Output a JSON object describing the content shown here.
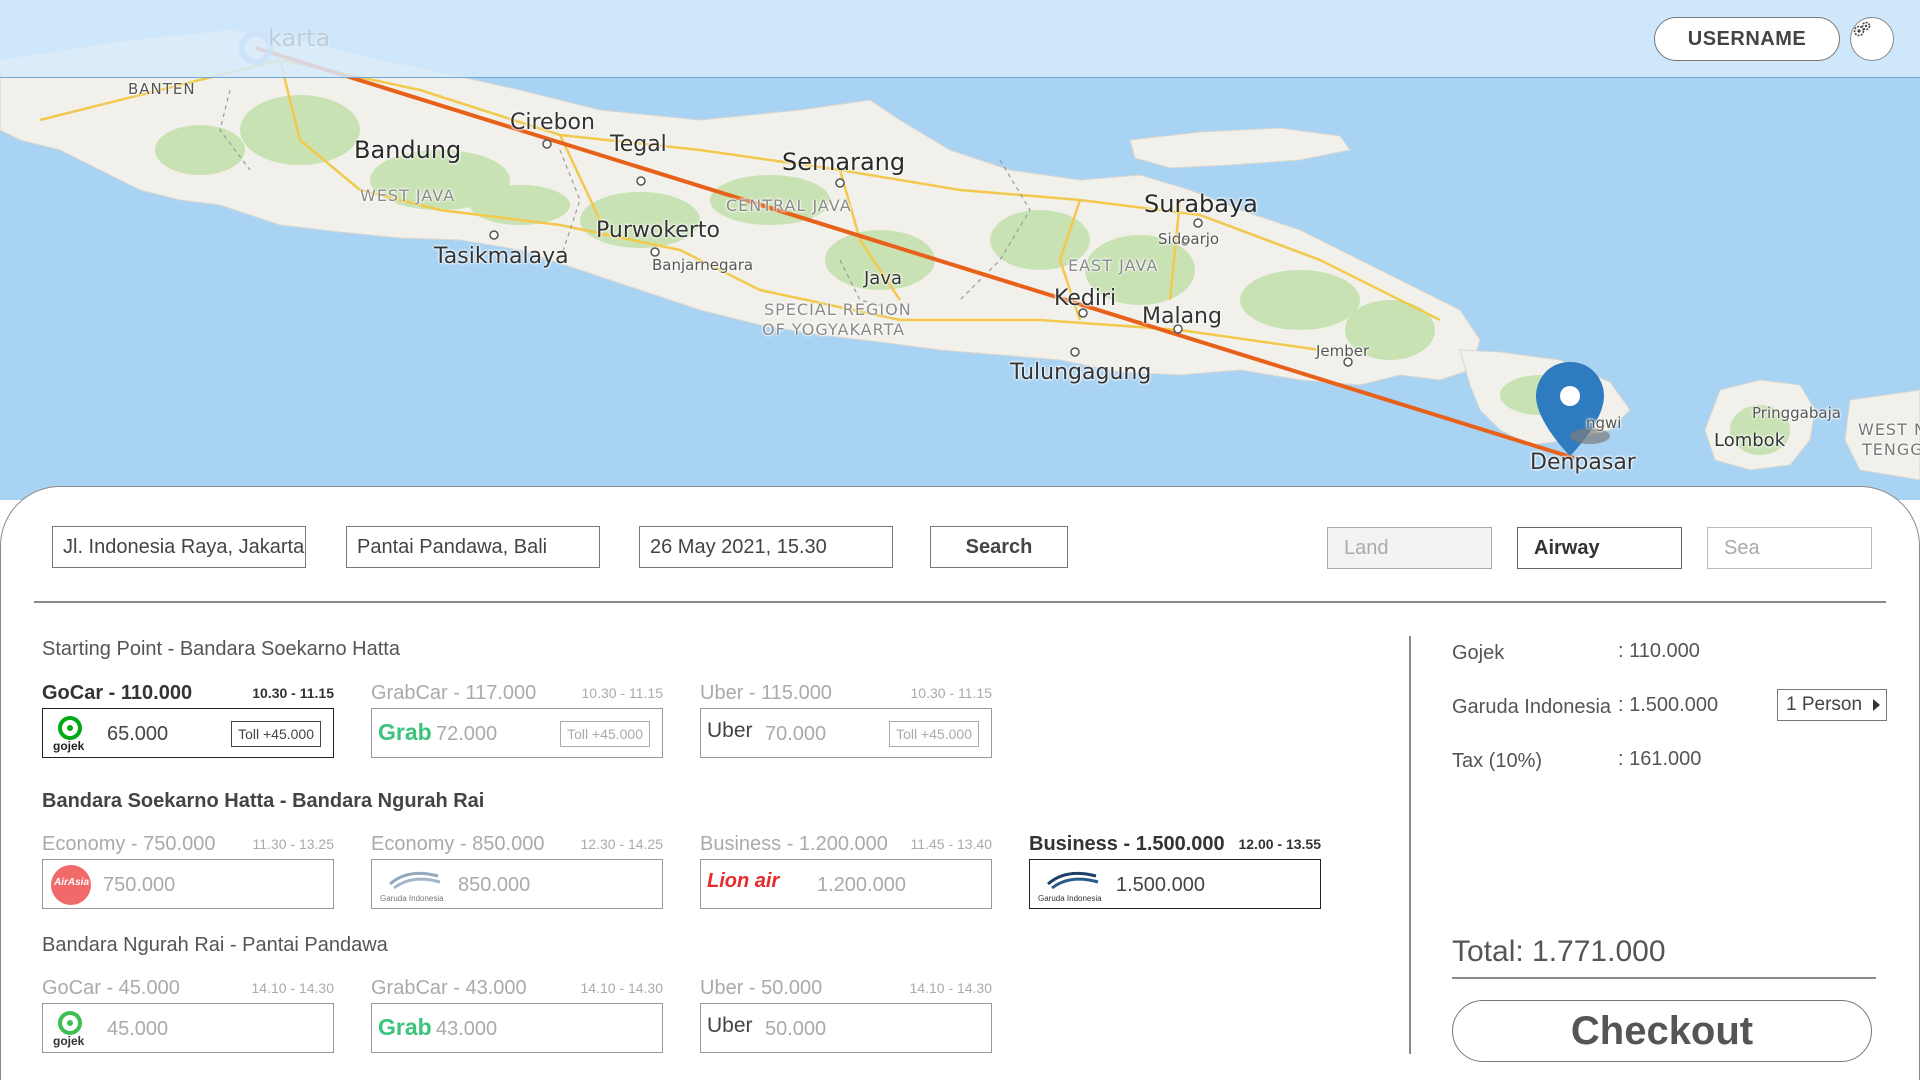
{
  "header": {
    "username": "USERNAME"
  },
  "map": {
    "labels": {
      "jakarta": "karta",
      "banten": "BANTEN",
      "cirebon": "Cirebon",
      "tegal": "Tegal",
      "bandung": "Bandung",
      "west_java": "WEST JAVA",
      "semarang": "Semarang",
      "central_java": "CENTRAL JAVA",
      "purwokerto": "Purwokerto",
      "banjarnegara": "Banjarnegara",
      "tasikmalaya": "Tasikmalaya",
      "java": "Java",
      "special_region": "SPECIAL REGION",
      "of_yogyakarta": "OF YOGYAKARTA",
      "surabaya": "Surabaya",
      "sidoarjo": "Sidoarjo",
      "east_java": "EAST JAVA",
      "kediri": "Kediri",
      "malang": "Malang",
      "tulungagung": "Tulungagung",
      "jember": "Jember",
      "bali_town": "ngwi",
      "denpasar": "Denpasar",
      "pringgabaja": "Pringgabaja",
      "lombok": "Lombok",
      "west_tenggara_1": "WEST N",
      "west_tenggara_2": "TENGG"
    }
  },
  "search": {
    "origin": "Jl. Indonesia Raya, Jakarta",
    "destination": "Pantai Pandawa, Bali",
    "datetime": "26 May 2021, 15.30",
    "search_label": "Search"
  },
  "modes": {
    "land": "Land",
    "airway": "Airway",
    "sea": "Sea"
  },
  "sections": [
    {
      "title": "Starting Point - Bandara Soekarno Hatta",
      "options": [
        {
          "label": "GoCar - 110.000",
          "time": "10.30 - 11.15",
          "price": "65.000",
          "toll": "Toll +45.000",
          "logo": "gojek",
          "selected": true
        },
        {
          "label": "GrabCar - 117.000",
          "time": "10.30 - 11.15",
          "price": "72.000",
          "toll": "Toll +45.000",
          "logo": "grab",
          "selected": false
        },
        {
          "label": "Uber - 115.000",
          "time": "10.30 - 11.15",
          "price": "70.000",
          "toll": "Toll +45.000",
          "logo": "uber",
          "selected": false
        }
      ]
    },
    {
      "title": "Bandara Soekarno Hatta - Bandara Ngurah Rai",
      "options": [
        {
          "label": "Economy - 750.000",
          "time": "11.30 - 13.25",
          "price": "750.000",
          "logo": "airasia",
          "selected": false
        },
        {
          "label": "Economy - 850.000",
          "time": "12.30 - 14.25",
          "price": "850.000",
          "logo": "garuda",
          "selected": false
        },
        {
          "label": "Business - 1.200.000",
          "time": "11.45 - 13.40",
          "price": "1.200.000",
          "logo": "lionair",
          "selected": false
        },
        {
          "label": "Business - 1.500.000",
          "time": "12.00 - 13.55",
          "price": "1.500.000",
          "logo": "garuda",
          "selected": true
        }
      ]
    },
    {
      "title": "Bandara Ngurah Rai - Pantai Pandawa",
      "options": [
        {
          "label": "GoCar - 45.000",
          "time": "14.10 - 14.30",
          "price": "45.000",
          "logo": "gojek",
          "selected": false
        },
        {
          "label": "GrabCar - 43.000",
          "time": "14.10 - 14.30",
          "price": "43.000",
          "logo": "grab",
          "selected": false
        },
        {
          "label": "Uber - 50.000",
          "time": "14.10 - 14.30",
          "price": "50.000",
          "logo": "uber",
          "selected": false
        }
      ]
    }
  ],
  "logos": {
    "gojek": "gojek",
    "grab": "Grab",
    "uber": "Uber",
    "airasia": "AirAsia",
    "garuda": "Garuda Indonesia",
    "lionair": "Lion air"
  },
  "summary": {
    "rows": [
      {
        "key": "Gojek",
        "value": ": 110.000"
      },
      {
        "key": "Garuda Indonesia",
        "value": ": 1.500.000"
      },
      {
        "key": "Tax (10%)",
        "value": ": 161.000"
      }
    ],
    "persons": "1 Person",
    "total": "Total: 1.771.000",
    "checkout": "Checkout"
  },
  "colors": {
    "route": "#e8611a",
    "pin": "#2f7bbf",
    "sea": "#a9d3f3",
    "land": "#f1f0eb",
    "forest": "#c9e2b4"
  }
}
